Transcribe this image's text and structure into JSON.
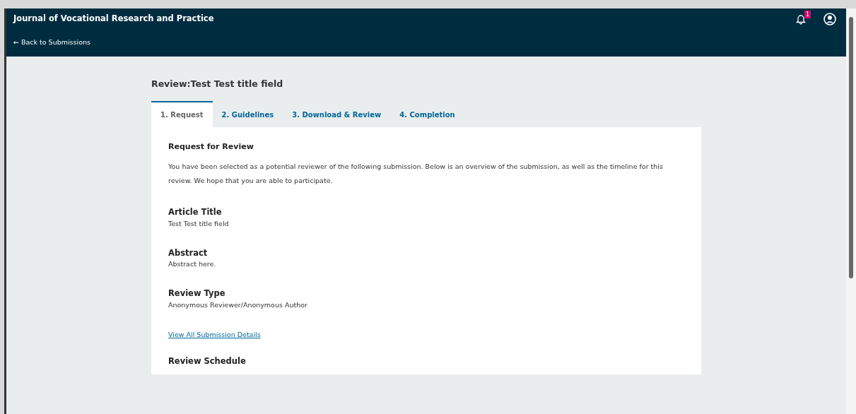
{
  "header": {
    "title": "Journal of Vocational Research and Practice",
    "back_link": "← Back to Submissions",
    "notification_count": "1"
  },
  "page_title": "Review:Test Test title field",
  "tabs": [
    {
      "label": "1. Request",
      "selected": true
    },
    {
      "label": "2. Guidelines",
      "selected": false
    },
    {
      "label": "3. Download & Review",
      "selected": false
    },
    {
      "label": "4. Completion",
      "selected": false
    }
  ],
  "panel": {
    "heading": "Request for Review",
    "intro": "You have been selected as a potential reviewer of the following submission. Below is an overview of the submission, as well as the timeline for this review. We hope that you are able to participate.",
    "fields": [
      {
        "label": "Article Title",
        "value": "Test Test title field"
      },
      {
        "label": "Abstract",
        "value": "Abstract here."
      },
      {
        "label": "Review Type",
        "value": "Anonymous Reviewer/Anonymous Author"
      }
    ],
    "details_link": "View All Submission Details",
    "next_heading": "Review Schedule"
  }
}
